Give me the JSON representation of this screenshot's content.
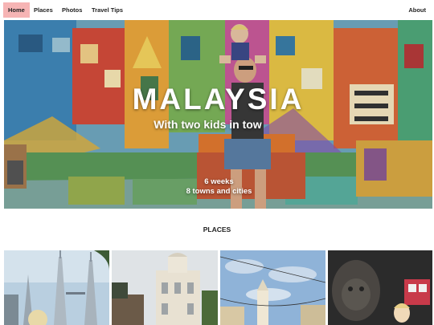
{
  "nav": {
    "home": "Home",
    "places": "Places",
    "photos": "Photos",
    "travel_tips": "Travel Tips",
    "about": "About",
    "active_color": "#f6b4b4"
  },
  "hero": {
    "title": "MALAYSIA",
    "subtitle": "With two kids in tow",
    "stat_line1": "6 weeks",
    "stat_line2": "8 towns and cities"
  },
  "places": {
    "heading": "PLACES"
  }
}
